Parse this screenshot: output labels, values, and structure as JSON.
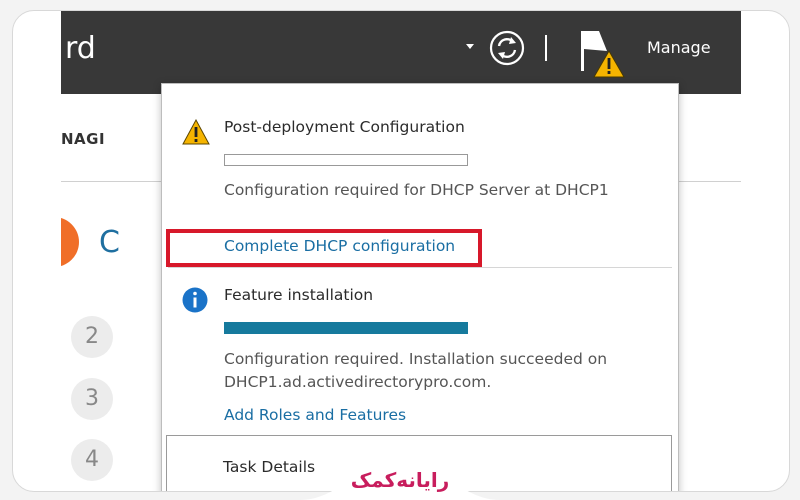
{
  "window": {
    "title_fragment": "rd",
    "nav_fragment": "NAGI",
    "content_fragment": "C",
    "manage_label": "Manage",
    "steps": [
      "2",
      "3",
      "4"
    ]
  },
  "icons": {
    "refresh": "refresh-icon",
    "flag": "flag-with-warning-icon",
    "warning": "warning-icon",
    "info": "info-icon"
  },
  "notifications": {
    "post_deployment": {
      "title": "Post-deployment Configuration",
      "progress": 0,
      "message": "Configuration required for DHCP Server at DHCP1",
      "link": "Complete DHCP configuration"
    },
    "feature_install": {
      "title": "Feature installation",
      "progress": 1.0,
      "message_line1": "Configuration required. Installation succeeded on",
      "message_line2": "DHCP1.ad.activedirectorypro.com.",
      "link": "Add Roles and Features"
    },
    "task_details_label": "Task Details"
  },
  "colors": {
    "titlebar": "#383838",
    "link": "#1a6ea3",
    "highlight": "#d7182a",
    "progress_fill": "#167a9d",
    "warning": "#f5b400",
    "info": "#1a73c8",
    "watermark": "#c81d5d"
  },
  "watermark": {
    "text": "رایانه‌کمک"
  }
}
